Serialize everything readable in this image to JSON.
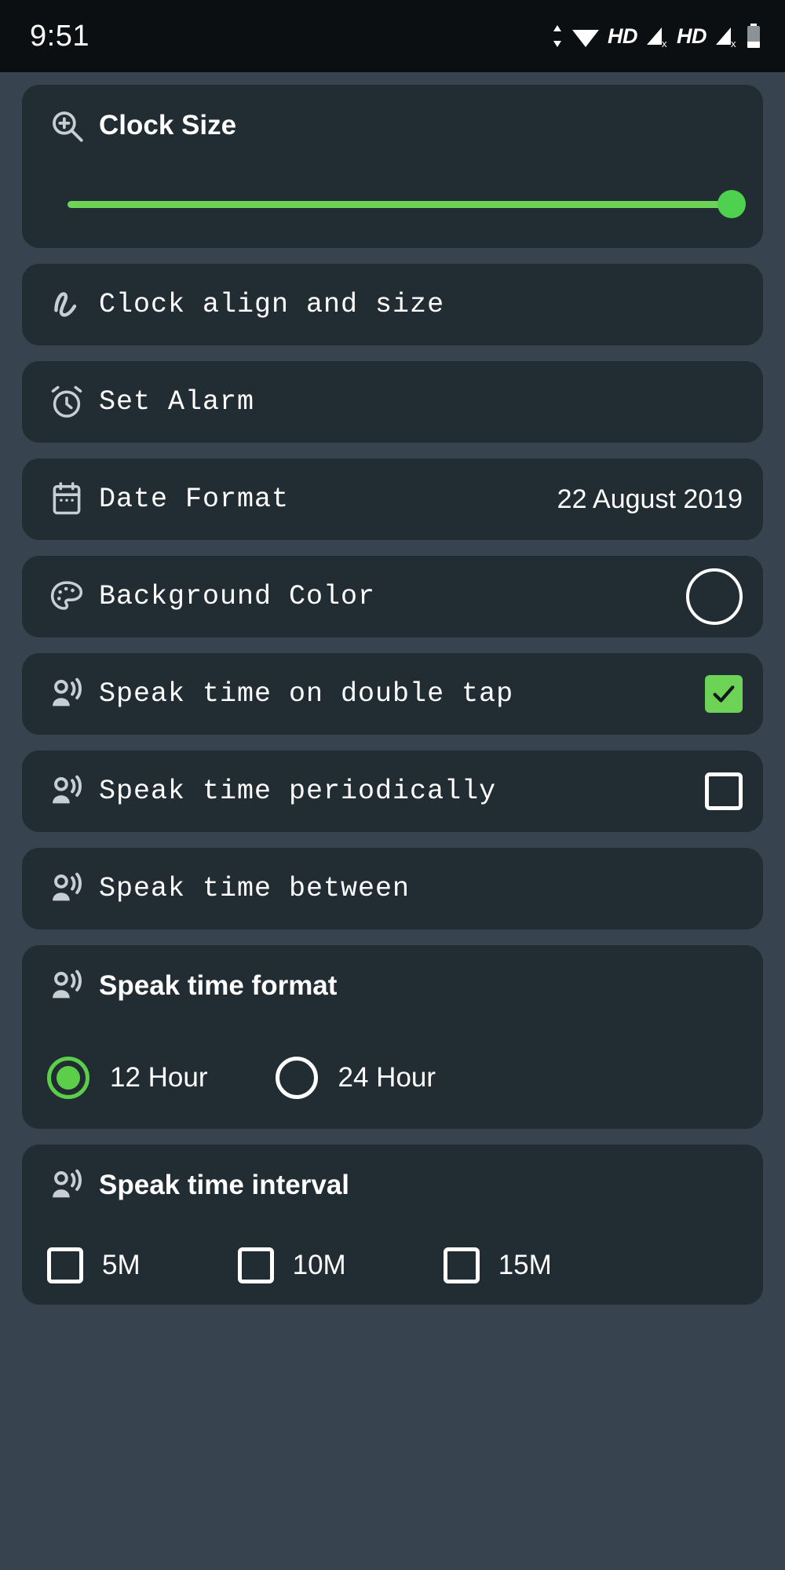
{
  "statusbar": {
    "time": "9:51",
    "icons": [
      {
        "name": "data-transfer-icon",
        "glyph": "up-down-arrows"
      },
      {
        "name": "wifi-icon",
        "glyph": "wifi-full"
      },
      {
        "name": "hd-voice-badge-1",
        "label": "HD"
      },
      {
        "name": "signal-no-service-icon-1",
        "glyph": "signal-x"
      },
      {
        "name": "hd-voice-badge-2",
        "label": "HD"
      },
      {
        "name": "signal-no-service-icon-2",
        "glyph": "signal-x"
      },
      {
        "name": "battery-icon",
        "glyph": "battery-low"
      }
    ]
  },
  "theme": {
    "page_background": "#374450",
    "card_background": "#222c33",
    "accent_green": "#6cd356",
    "thumb_green": "#4ed14e",
    "radio_green": "#5ccf4a",
    "text_primary": "#ffffff",
    "statusbar_background": "#0c0f11"
  },
  "settings": {
    "clock_size": {
      "title": "Clock Size",
      "icon": "zoom-in-icon",
      "slider_value": 100,
      "slider_min": 0,
      "slider_max": 100
    },
    "clock_align": {
      "title": "Clock align and size",
      "icon": "gesture-icon"
    },
    "set_alarm": {
      "title": "Set Alarm",
      "icon": "alarm-clock-icon"
    },
    "date_format": {
      "title": "Date Format",
      "icon": "calendar-icon",
      "value": "22 August 2019"
    },
    "background_color": {
      "title": "Background Color",
      "icon": "palette-icon",
      "swatch_color": "#222c33"
    },
    "speak_double_tap": {
      "title": "Speak time on double tap",
      "icon": "record-voice-over-icon",
      "checked": true
    },
    "speak_periodically": {
      "title": "Speak time periodically",
      "icon": "record-voice-over-icon",
      "checked": false
    },
    "speak_between": {
      "title": "Speak time between",
      "icon": "record-voice-over-icon"
    },
    "speak_format": {
      "title": "Speak time format",
      "icon": "record-voice-over-icon",
      "options": [
        {
          "label": "12 Hour",
          "selected": true
        },
        {
          "label": "24 Hour",
          "selected": false
        }
      ]
    },
    "speak_interval": {
      "title": "Speak time interval",
      "icon": "record-voice-over-icon",
      "options": [
        {
          "label": "5M",
          "checked": false
        },
        {
          "label": "10M",
          "checked": false
        },
        {
          "label": "15M",
          "checked": false
        }
      ]
    }
  }
}
